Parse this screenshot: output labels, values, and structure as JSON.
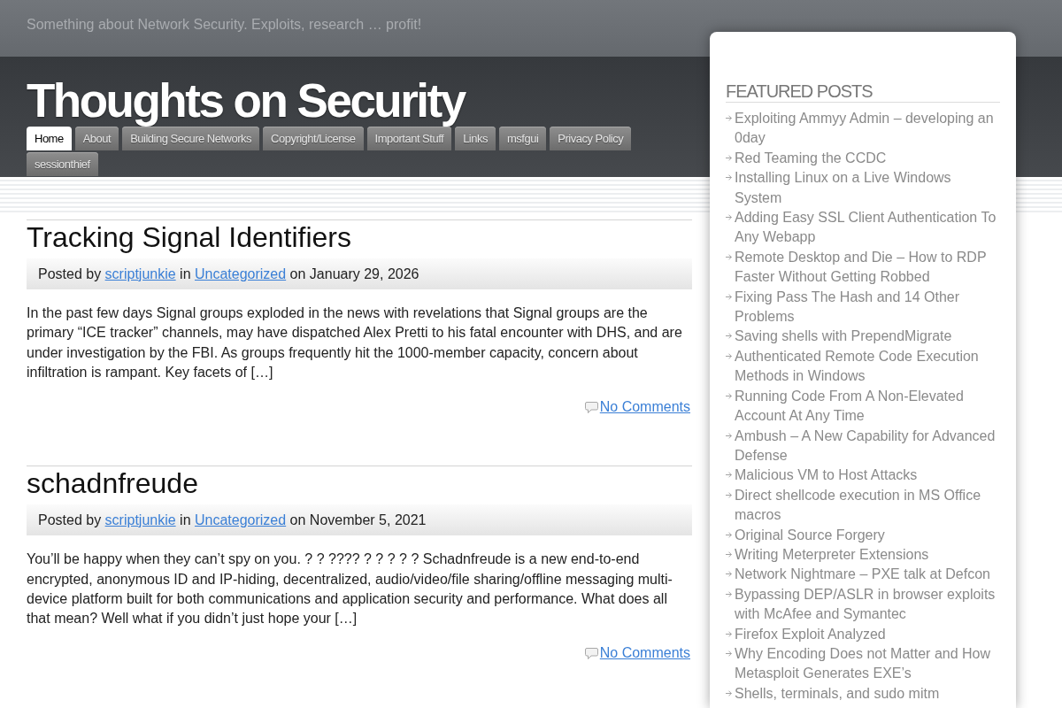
{
  "header": {
    "tagline": "Something about Network Security. Exploits, research … profit!",
    "title": "Thoughts on Security"
  },
  "nav": [
    {
      "label": "Home",
      "selected": true
    },
    {
      "label": "About",
      "selected": false
    },
    {
      "label": "Building Secure Networks",
      "selected": false
    },
    {
      "label": "Copyright/License",
      "selected": false
    },
    {
      "label": "Important Stuff",
      "selected": false
    },
    {
      "label": "Links",
      "selected": false
    },
    {
      "label": "msfgui",
      "selected": false
    },
    {
      "label": "Privacy Policy",
      "selected": false
    },
    {
      "label": "sessionthief",
      "selected": false
    }
  ],
  "posts": [
    {
      "title": "Tracking Signal Identifiers",
      "meta": {
        "prefix": "Posted by",
        "author": "scriptjunkie",
        "category_prefix": "in",
        "category": "Uncategorized",
        "date_prefix": "on",
        "date": "January 29, 2026"
      },
      "excerpt": "In the past few days Signal groups exploded in the news with revelations that Signal groups are the primary “ICE tracker” channels, may have dispatched Alex Pretti to his fatal encounter with DHS, and are under investigation by the FBI. As groups frequently hit the 1000-member capacity, concern about infiltration is rampant. Key facets of […]",
      "comments": "No Comments"
    },
    {
      "title": "schadnfreude",
      "meta": {
        "prefix": "Posted by",
        "author": "scriptjunkie",
        "category_prefix": "in",
        "category": "Uncategorized",
        "date_prefix": "on",
        "date": "November 5, 2021"
      },
      "excerpt": "You’ll be happy when they can’t spy on you. ? ? ???? ? ? ? ? ? Schadnfreude is a new end-to-end encrypted, anonymous ID and IP-hiding, decentralized, audio/video/file sharing/offline messaging multi-device platform built for both communications and application security and performance. What does all that mean? Well what if you didn’t just hope your […]",
      "comments": "No Comments"
    }
  ],
  "sidebar": {
    "heading": "FEATURED POSTS",
    "items": [
      "Exploiting Ammyy Admin – developing an 0day",
      "Red Teaming the CCDC",
      "Installing Linux on a Live Windows System",
      "Adding Easy SSL Client Authentication To Any Webapp",
      "Remote Desktop and Die – How to RDP Faster Without Getting Robbed",
      "Fixing Pass The Hash and 14 Other Problems",
      "Saving shells with PrependMigrate",
      "Authenticated Remote Code Execution Methods in Windows",
      "Running Code From A Non-Elevated Account At Any Time",
      "Ambush – A New Capability for Advanced Defense",
      "Malicious VM to Host Attacks",
      "Direct shellcode execution in MS Office macros",
      "Original Source Forgery",
      "Writing Meterpreter Extensions",
      "Network Nightmare – PXE talk at Defcon",
      "Bypassing DEP/ASLR in browser exploits with McAfee and Symantec",
      "Firefox Exploit Analyzed",
      "Why Encoding Does not Matter and How Metasploit Generates EXE’s",
      "Shells, terminals, and sudo mitm"
    ]
  }
}
